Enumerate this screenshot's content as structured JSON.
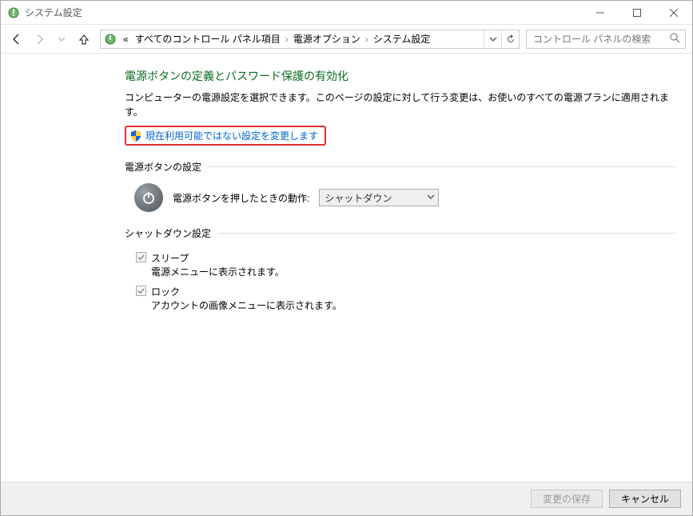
{
  "window": {
    "title": "システム設定"
  },
  "breadcrumb": {
    "prefix": "«",
    "items": [
      "すべてのコントロール パネル項目",
      "電源オプション",
      "システム設定"
    ]
  },
  "search": {
    "placeholder": "コントロール パネルの検索"
  },
  "page": {
    "title": "電源ボタンの定義とパスワード保護の有効化",
    "description": "コンピューターの電源設定を選択できます。このページの設定に対して行う変更は、お使いのすべての電源プランに適用されます。",
    "admin_link": "現在利用可能ではない設定を変更します"
  },
  "power_button": {
    "group_label": "電源ボタンの設定",
    "row_label": "電源ボタンを押したときの動作:",
    "selected": "シャットダウン"
  },
  "shutdown": {
    "group_label": "シャットダウン設定",
    "items": [
      {
        "title": "スリープ",
        "sub": "電源メニューに表示されます。"
      },
      {
        "title": "ロック",
        "sub": "アカウントの画像メニューに表示されます。"
      }
    ]
  },
  "buttons": {
    "save": "変更の保存",
    "cancel": "キャンセル"
  }
}
